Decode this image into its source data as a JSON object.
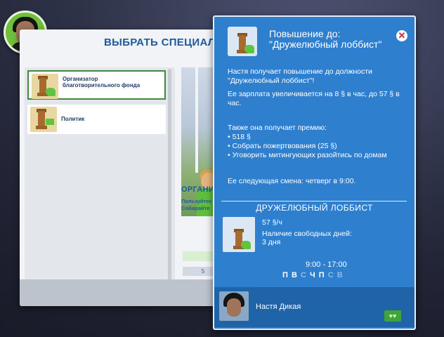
{
  "modal": {
    "title": "ВЫБРАТЬ СПЕЦИАЛИЗАЦ",
    "list": [
      {
        "label": "Организатор благотворительного фонда",
        "selected": true,
        "icon": "podium-heart-icon"
      },
      {
        "label": "Политик",
        "selected": false,
        "icon": "podium-flag-icon"
      }
    ],
    "description": {
      "title": "ОРГАНИЗ",
      "lines": [
        "Пользуйтес",
        "Собирайте"
      ]
    },
    "bottom_button": "5"
  },
  "tooltip": {
    "header": "Повышение до: \"Дружелюбный лоббист\"",
    "close_icon": "close-icon",
    "paragraphs": [
      "Настя получает повышение до должности \"Дружелюбный лоббист\"!",
      "Ее зарплата увеличивается на 8 § в час, до 57 § в час.",
      "Также она получает премию:",
      "• 518 §",
      "• Собрать пожертвования (25 §)",
      "• Уговорить митингующих разойтись по домам",
      "Ее следующая смена: четверг в 9:00."
    ],
    "career_title": "ДРУЖЕЛЮБНЫЙ ЛОББИСТ",
    "salary": "57 §/ч",
    "free_days_label": "Наличие свободных дней:",
    "free_days_value": "3 дня",
    "hours": "9:00 - 17:00",
    "days": [
      {
        "letter": "П",
        "active": true
      },
      {
        "letter": "В",
        "active": true
      },
      {
        "letter": "С",
        "active": false
      },
      {
        "letter": "Ч",
        "active": true
      },
      {
        "letter": "П",
        "active": true
      },
      {
        "letter": "С",
        "active": false
      },
      {
        "letter": "В",
        "active": false
      }
    ],
    "sim_name": "Настя Дикая"
  },
  "colors": {
    "tooltip_bg": "#2f7fcf",
    "accent_green": "#5fc43f",
    "title_blue": "#1f5a9a",
    "close_red": "#c9283a"
  }
}
